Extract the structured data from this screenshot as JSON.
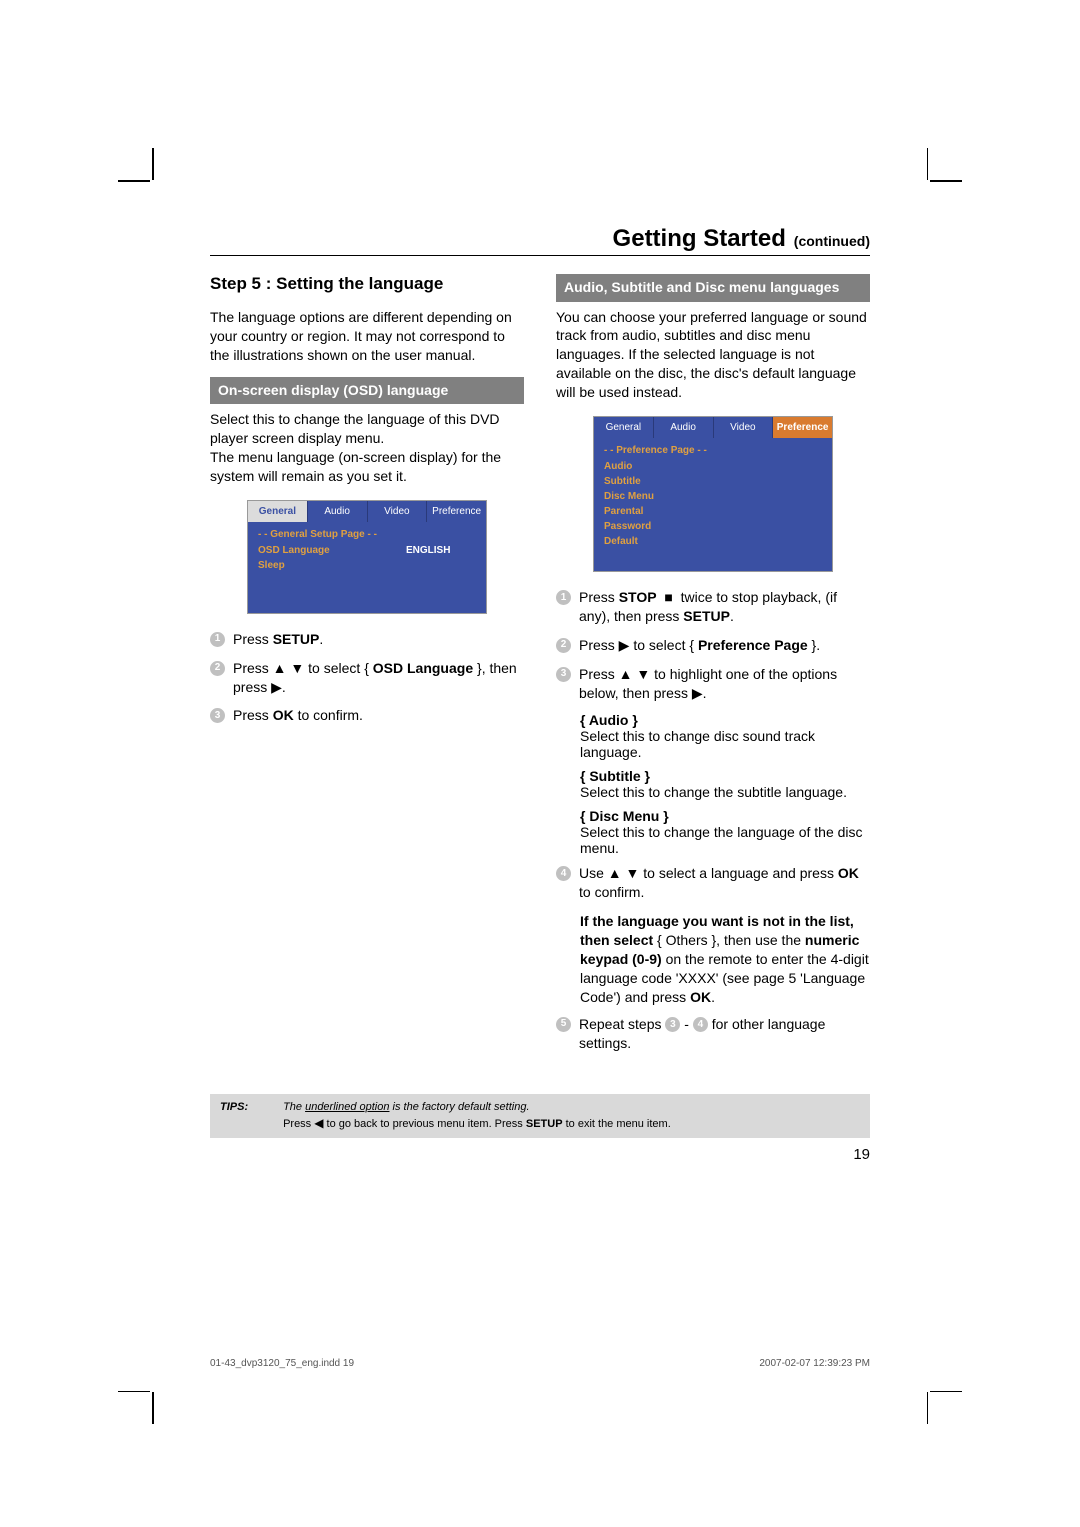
{
  "title": {
    "main": "Getting Started",
    "sub": "(continued)"
  },
  "left": {
    "step_heading": "Step 5 :  Setting the language",
    "intro": "The language options are different depending on your country or region. It may not correspond to the illustrations shown on the user manual.",
    "osd_bar": "On-screen display (OSD) language",
    "osd_desc1": "Select this to change the language of this DVD player screen display menu.",
    "osd_desc2": "The menu language (on-screen display) for the system will remain as you set it.",
    "osd_menu": {
      "tabs": [
        "General",
        "Audio",
        "Video",
        "Preference"
      ],
      "active_tab": 0,
      "page_title": "- -   General Setup Page   - -",
      "rows": [
        {
          "left": "OSD Language",
          "right": "ENGLISH",
          "hl": true
        },
        {
          "left": "Sleep",
          "right": "",
          "hl": false
        }
      ]
    },
    "steps": [
      {
        "n": "1",
        "html": "Press <b>SETUP</b>."
      },
      {
        "n": "2",
        "html": "Press ▲ ▼ to select { <b>OSD Language</b> }, then press ▶."
      },
      {
        "n": "3",
        "html": "Press <b>OK</b> to confirm."
      }
    ]
  },
  "right": {
    "bar": "Audio, Subtitle and Disc menu languages",
    "intro": "You can choose your preferred language or sound track from audio, subtitles and disc menu languages. If the selected language is not available on the disc, the disc's default language will be used instead.",
    "osd_menu": {
      "tabs": [
        "General",
        "Audio",
        "Video",
        "Preference"
      ],
      "highlight_tab": 3,
      "page_title": "- -   Preference Page   - -",
      "rows": [
        {
          "left": "Audio"
        },
        {
          "left": "Subtitle"
        },
        {
          "left": "Disc Menu"
        },
        {
          "left": "Parental"
        },
        {
          "left": "Password"
        },
        {
          "left": "Default"
        }
      ]
    },
    "steps_a": [
      {
        "n": "1",
        "html": "Press <b>STOP</b>&nbsp; ■ &nbsp;twice to stop playback, (if any), then press <b>SETUP</b>."
      },
      {
        "n": "2",
        "html": "Press ▶ to select { <b>Preference Page</b> }."
      },
      {
        "n": "3",
        "html": "Press ▲ ▼ to highlight one of the options below, then press ▶."
      }
    ],
    "options": [
      {
        "label": "{ Audio }",
        "desc": "Select this to change disc sound track language."
      },
      {
        "label": "{ Subtitle }",
        "desc": "Select this to change the subtitle language."
      },
      {
        "label": "{ Disc Menu }",
        "desc": "Select this to change the language of the disc menu."
      }
    ],
    "steps_b": [
      {
        "n": "4",
        "html": "Use ▲ ▼ to select a language and press <b>OK</b> to confirm."
      }
    ],
    "note_html": "<b>If the language you want is not in the list, then select</b> { Others }, then use the <b>numeric keypad (0-9)</b> on the remote to enter the 4-digit language code 'XXXX' (see page 5 'Language Code') and press <b>OK</b>.",
    "steps_c": [
      {
        "n": "5",
        "html": "Repeat steps <span class='step-no inline'>3</span> - <span class='step-no inline'>4</span> for other language settings."
      }
    ]
  },
  "tips": {
    "label": "TIPS:",
    "line1_pre": "The ",
    "line1_under": "underlined option",
    "line1_post": " is the factory default setting.",
    "line2": "Press ◀ to go back to previous menu item. Press SETUP to exit the menu item."
  },
  "page_number": "19",
  "footer_left": "01-43_dvp3120_75_eng.indd   19",
  "footer_right": "2007-02-07   12:39:23 PM"
}
